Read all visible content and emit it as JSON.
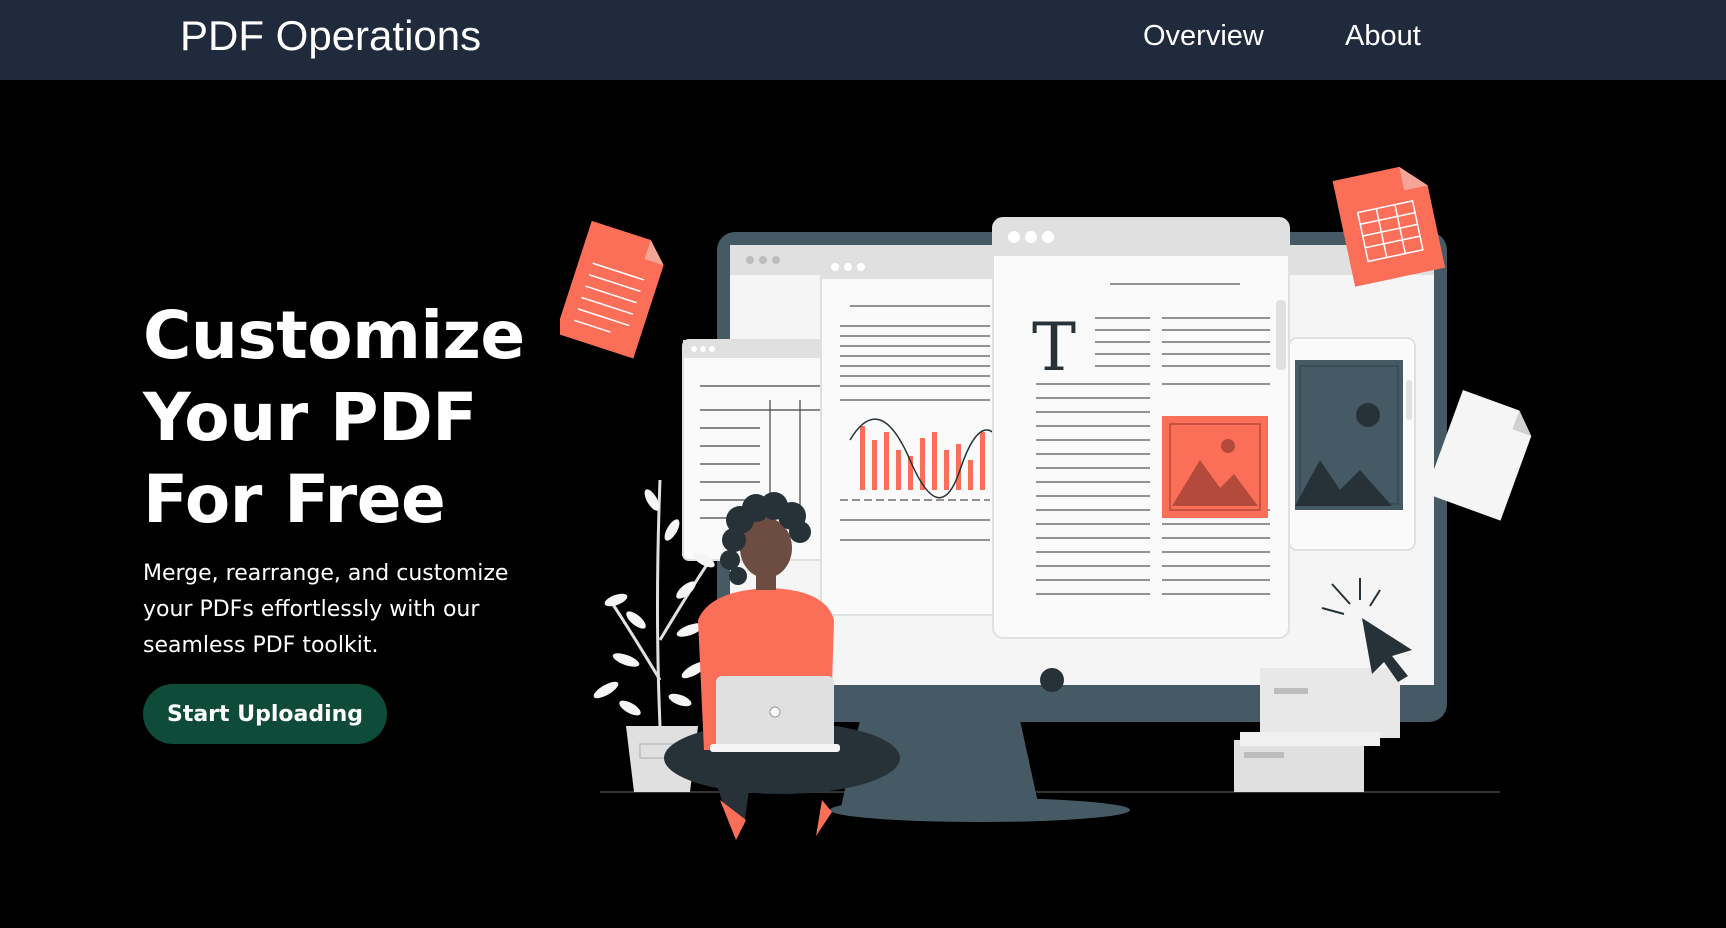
{
  "nav": {
    "brand": "PDF Operations",
    "links": [
      {
        "label": "Overview"
      },
      {
        "label": "About"
      }
    ]
  },
  "hero": {
    "title_lines": [
      "Customize",
      "Your PDF",
      "For Free"
    ],
    "description": "Merge, rearrange, and customize your PDFs effortlessly with our seamless PDF toolkit.",
    "cta_label": "Start Uploading"
  },
  "illustration": {
    "doc_letter": "T"
  },
  "colors": {
    "nav_bg": "#1f2a3c",
    "page_bg": "#000000",
    "accent": "#fb6f59",
    "cta_bg": "#0e4b38",
    "monitor": "#455a64"
  }
}
